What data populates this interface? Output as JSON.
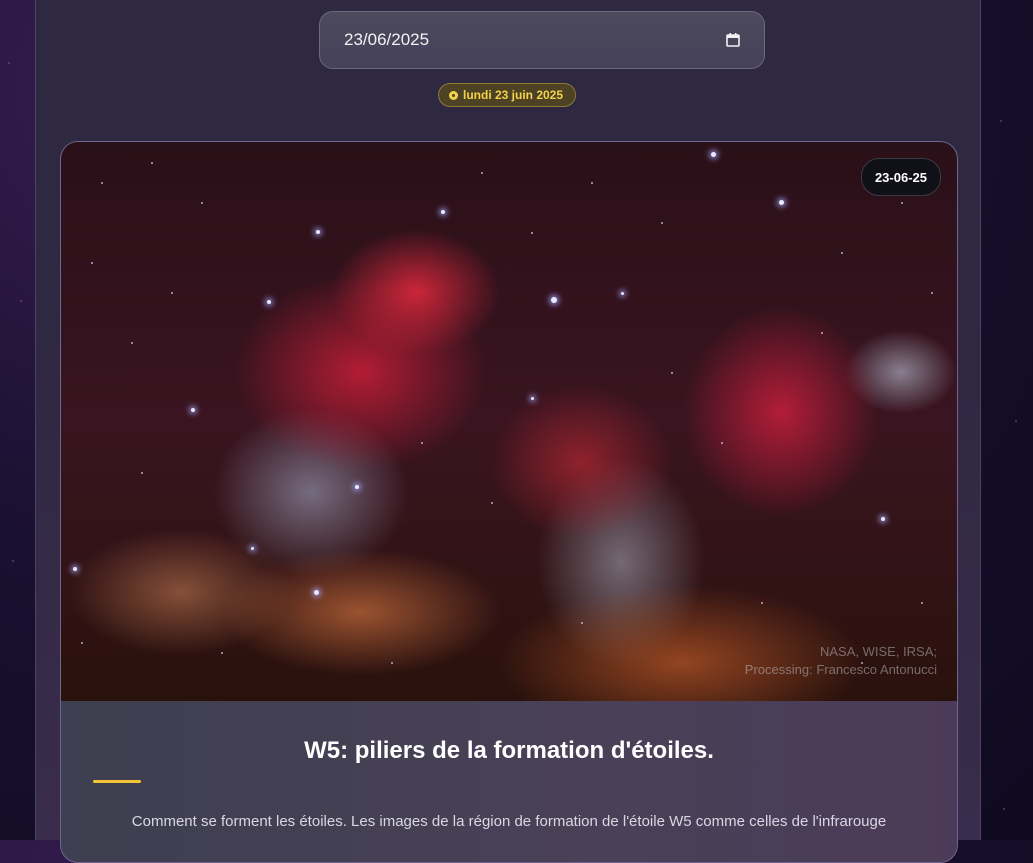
{
  "date_picker": {
    "value": "23/06/2025",
    "icon": "calendar-icon"
  },
  "date_badge": {
    "label": "lundi 23 juin 2025",
    "accent": "#f3d24a"
  },
  "apod_card": {
    "image_code_badge": "23-06-25",
    "image_credit_line1": "NASA, WISE, IRSA;",
    "image_credit_line2": "Processing: Francesco Antonucci",
    "title": "W5: piliers de la formation d'étoiles.",
    "description": "Comment se forment les étoiles. Les images de la région de formation de l'étoile W5 comme celles de l'infrarouge",
    "accent": "#f3c537"
  }
}
